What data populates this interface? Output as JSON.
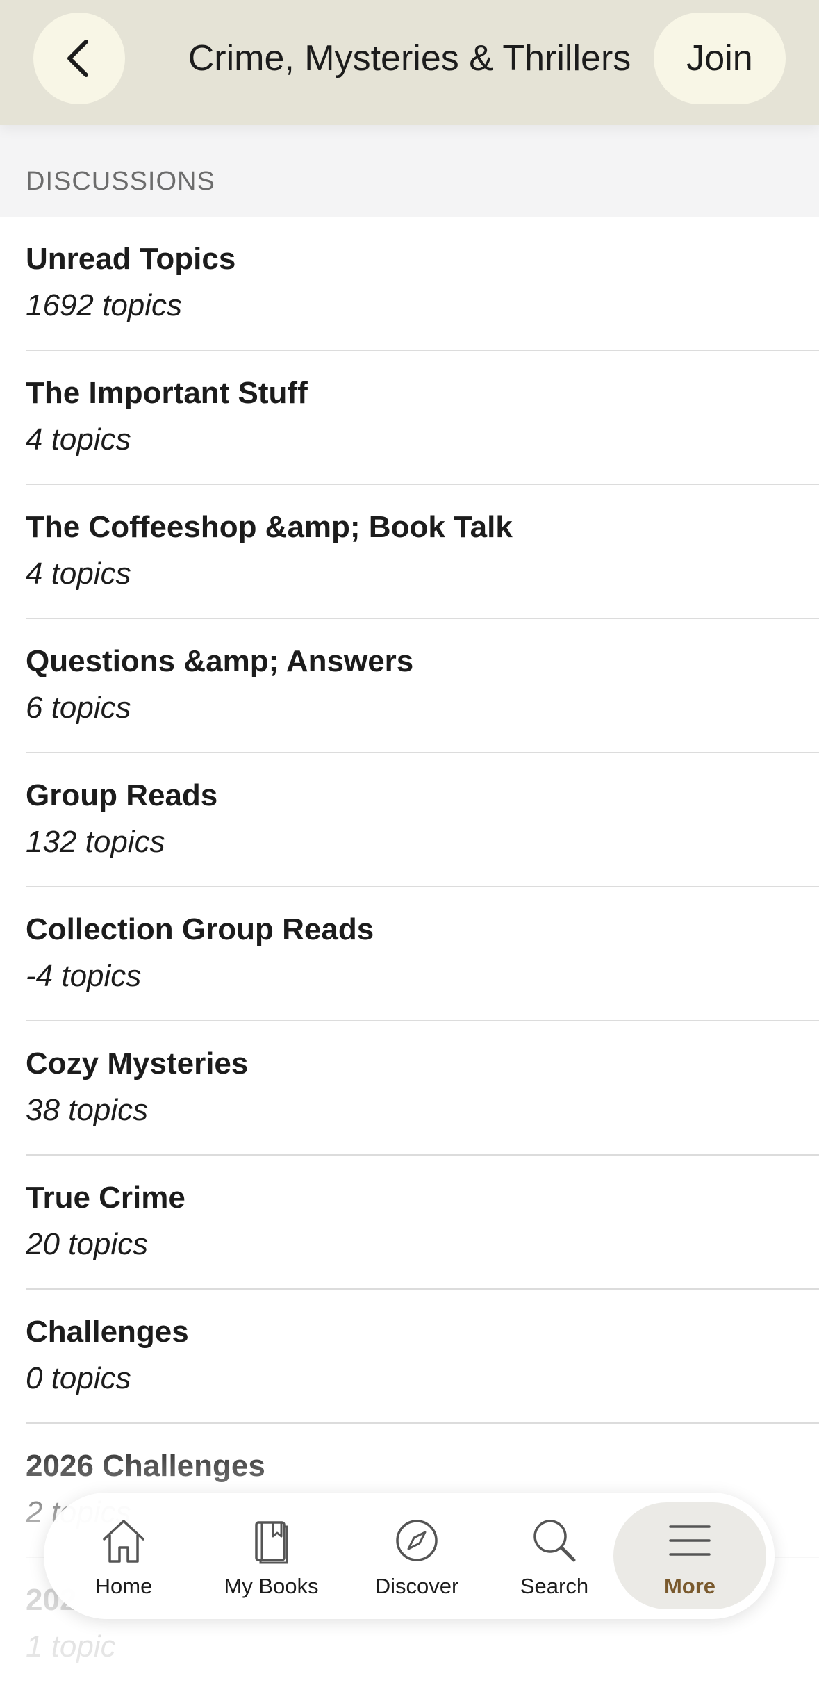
{
  "header": {
    "title": "Crime, Mysteries & Thrillers",
    "join_label": "Join",
    "back_icon": "chevron-left-icon"
  },
  "section": {
    "label": "DISCUSSIONS"
  },
  "topics": [
    {
      "title": "Unread Topics",
      "count": "1692 topics"
    },
    {
      "title": "The Important Stuff",
      "count": "4 topics"
    },
    {
      "title": "The Coffeeshop &amp; Book Talk",
      "count": "4 topics"
    },
    {
      "title": "Questions &amp; Answers",
      "count": "6 topics"
    },
    {
      "title": "Group Reads",
      "count": "132 topics"
    },
    {
      "title": "Collection Group Reads",
      "count": "-4 topics"
    },
    {
      "title": "Cozy Mysteries",
      "count": "38 topics"
    },
    {
      "title": "True Crime",
      "count": "20 topics"
    },
    {
      "title": "Challenges",
      "count": "0 topics"
    },
    {
      "title": "2026 Challenges",
      "count": "2 topics"
    },
    {
      "title": "202",
      "count": "1 topic"
    }
  ],
  "tabbar": {
    "items": [
      {
        "label": "Home",
        "icon": "home-icon"
      },
      {
        "label": "My Books",
        "icon": "my-books-icon"
      },
      {
        "label": "Discover",
        "icon": "compass-icon"
      },
      {
        "label": "Search",
        "icon": "search-icon"
      },
      {
        "label": "More",
        "icon": "menu-icon"
      }
    ],
    "active": "More",
    "active_color": "#7a5a2e"
  },
  "colors": {
    "header_bg": "#e5e3d6",
    "button_bg": "#f8f6e6",
    "section_bg": "#f4f4f5"
  }
}
